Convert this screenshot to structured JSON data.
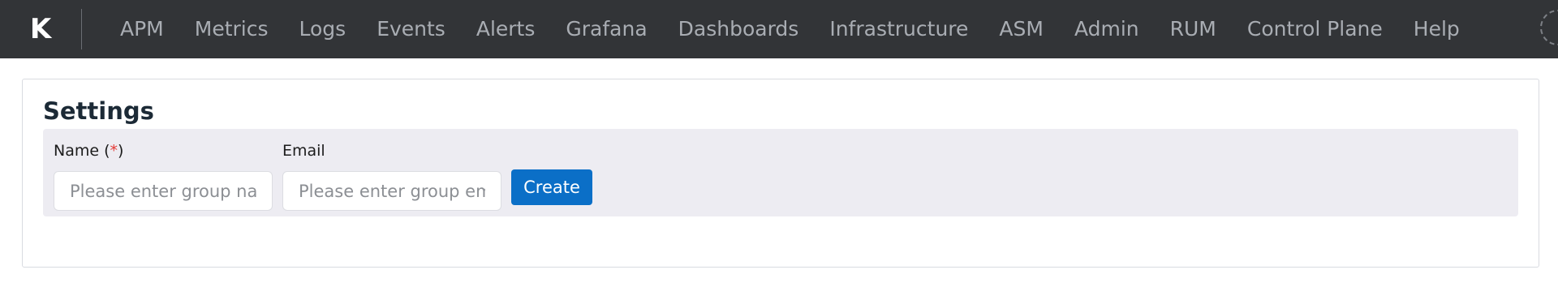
{
  "brand": {
    "logo_text": "K"
  },
  "nav": {
    "items": [
      {
        "label": "APM"
      },
      {
        "label": "Metrics"
      },
      {
        "label": "Logs"
      },
      {
        "label": "Events"
      },
      {
        "label": "Alerts"
      },
      {
        "label": "Grafana"
      },
      {
        "label": "Dashboards"
      },
      {
        "label": "Infrastructure"
      },
      {
        "label": "ASM"
      },
      {
        "label": "Admin"
      },
      {
        "label": "RUM"
      },
      {
        "label": "Control Plane"
      },
      {
        "label": "Help"
      }
    ],
    "user_icon": "avatar-icon"
  },
  "settings": {
    "title": "Settings",
    "name_label": "Name (",
    "name_required_mark": "*",
    "name_label_close": ")",
    "name_value": "",
    "name_placeholder": "Please enter group name",
    "email_label": "Email",
    "email_value": "",
    "email_placeholder": "Please enter group email",
    "create_label": "Create"
  },
  "colors": {
    "topbar_bg": "#323437",
    "nav_text": "#a9adb3",
    "panel_bg": "#edecf2",
    "primary_button": "#0b6fc7",
    "required_mark": "#e53935"
  }
}
